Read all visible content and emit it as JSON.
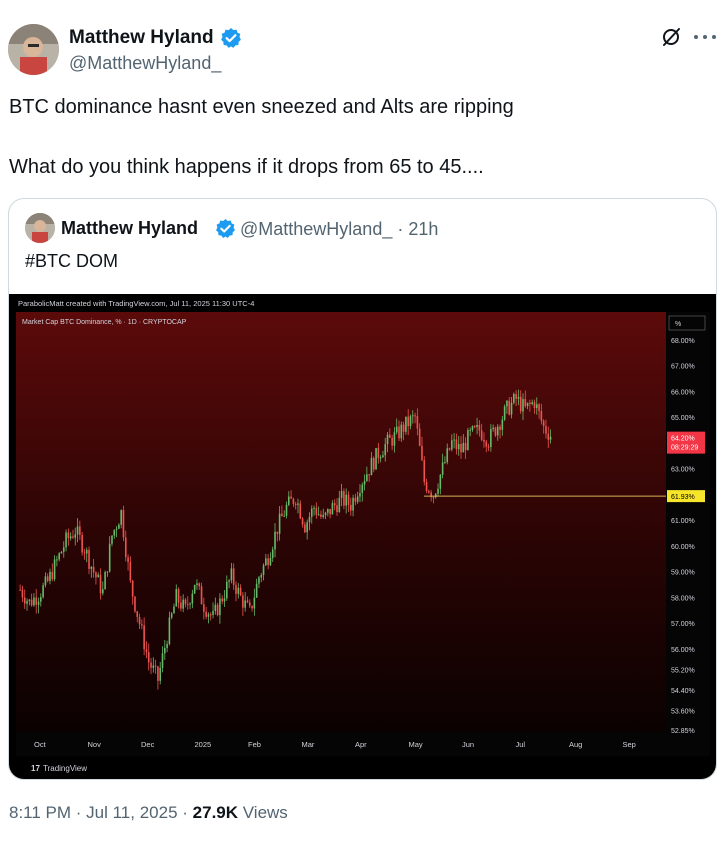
{
  "author": {
    "name": "Matthew Hyland",
    "handle": "@MatthewHyland_"
  },
  "tweet": {
    "line1": "BTC dominance hasnt even sneezed and Alts are ripping",
    "line2": "What do you think happens if it drops from 65 to 45...."
  },
  "quote": {
    "name": "Matthew Hyland",
    "handle": "@MatthewHyland_",
    "time": "· 21h",
    "text": "#BTC DOM"
  },
  "chart_header": {
    "created_by": "ParabolicMatt created with TradingView.com, Jul 11, 2025 11:30 UTC-4",
    "symbol": "Market Cap BTC Dominance, % · 1D · CRYPTOCAP",
    "scale_label": "%",
    "watermark": "TradingView"
  },
  "chart_data": {
    "type": "line",
    "title": "Market Cap BTC Dominance, % · 1D · CRYPTOCAP",
    "y_unit": "%",
    "ylim": [
      52.85,
      69.0
    ],
    "y_ticks": [
      "68.00%",
      "67.00%",
      "66.00%",
      "65.00%",
      "63.00%",
      "61.00%",
      "60.00%",
      "59.00%",
      "58.00%",
      "57.00%",
      "56.00%",
      "55.20%",
      "54.40%",
      "53.60%",
      "52.85%"
    ],
    "x_ticks": [
      "Oct",
      "Nov",
      "Dec",
      "2025",
      "Feb",
      "Mar",
      "Apr",
      "May",
      "Jun",
      "Jul",
      "Aug",
      "Sep"
    ],
    "series": [
      {
        "values": [
          58.3,
          57.8,
          58.1,
          58.6,
          59.4,
          60.2,
          60.6,
          59.9,
          59.0,
          58.2,
          60.4,
          61.3,
          58.5,
          57.0,
          55.5,
          54.8,
          56.5,
          58.0,
          57.5,
          58.6,
          57.7,
          57.2,
          58.0,
          58.8,
          58.0,
          57.4,
          58.8,
          59.6,
          60.7,
          61.5,
          61.9,
          60.8,
          61.5,
          61.0,
          61.5,
          61.8,
          61.6,
          62.4,
          63.0,
          63.6,
          64.0,
          64.3,
          64.7,
          65.0,
          62.5,
          62.0,
          63.0,
          64.0,
          63.7,
          64.3,
          64.5,
          64.1,
          64.7,
          65.3,
          65.7,
          65.3,
          65.6,
          64.6,
          64.2
        ]
      }
    ],
    "current_value_label": "64.20%",
    "countdown_label": "08:29:29",
    "support_label": "61.93%",
    "colors": {
      "up": "#66bb6a",
      "down": "#ef5350",
      "current_badge": "#f23645",
      "support_badge": "#f7e52b",
      "support_line": "#d4b452"
    }
  },
  "meta": {
    "time": "8:11 PM · Jul 11, 2025 ·",
    "views_count": "27.9K",
    "views_label": "Views"
  }
}
